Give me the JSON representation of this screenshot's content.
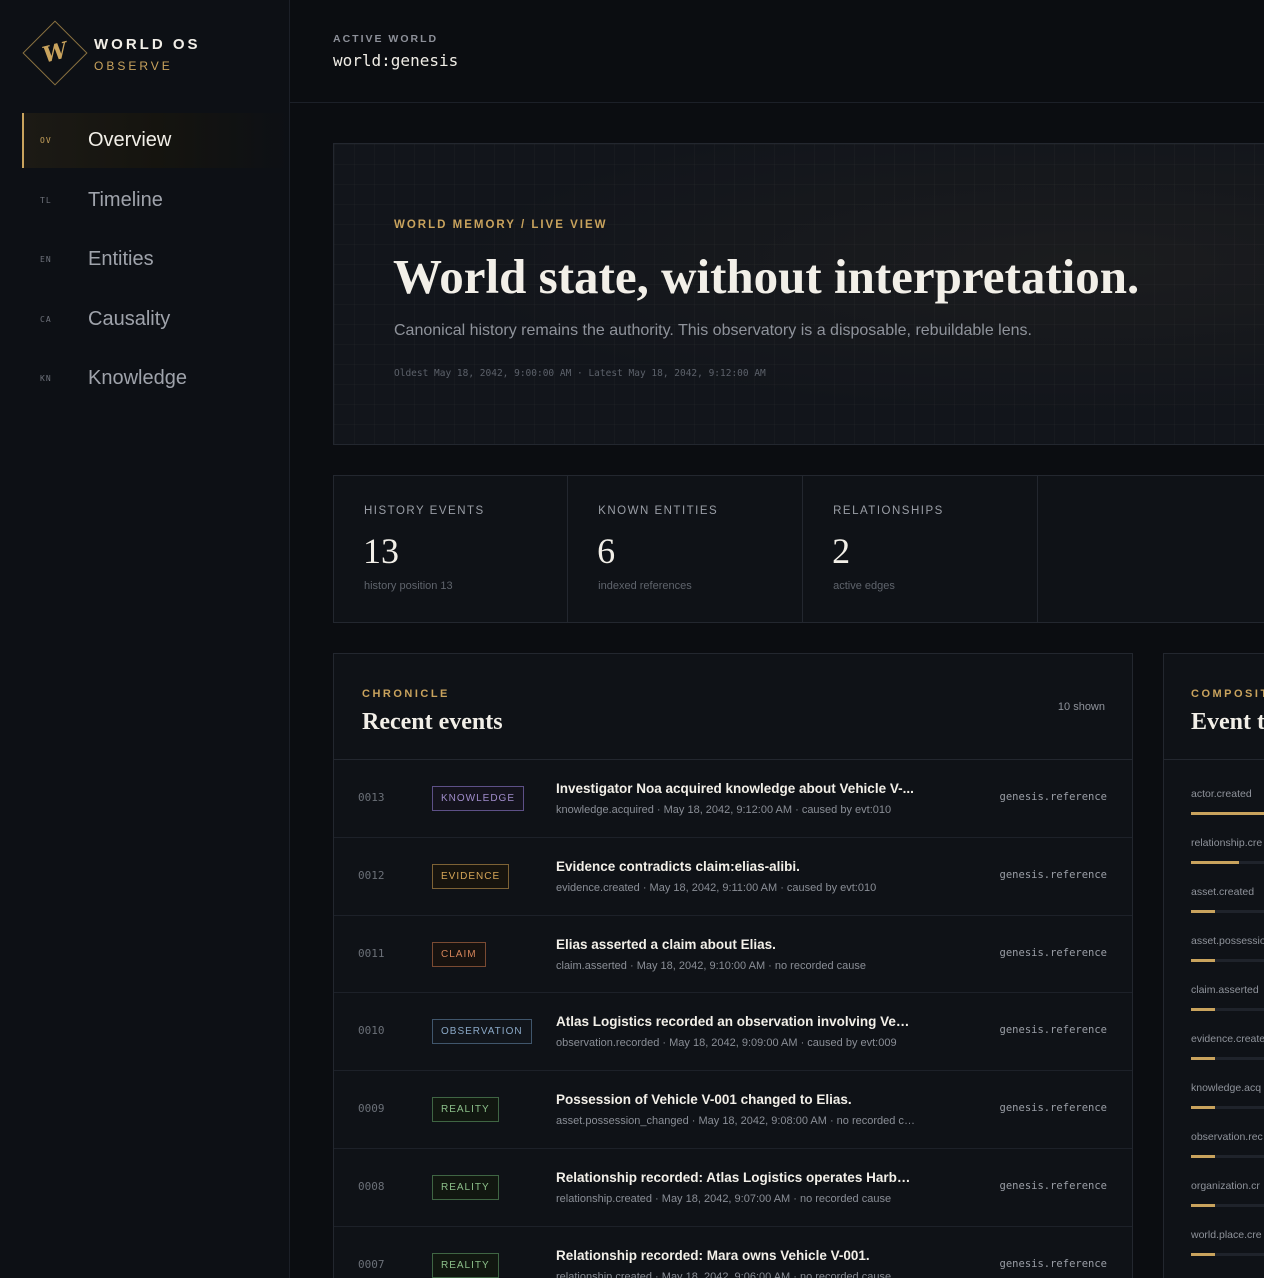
{
  "brand": {
    "glyph": "W",
    "title": "WORLD OS",
    "subtitle": "OBSERVE"
  },
  "nav": [
    {
      "code": "OV",
      "label": "Overview",
      "active": true
    },
    {
      "code": "TL",
      "label": "Timeline"
    },
    {
      "code": "EN",
      "label": "Entities"
    },
    {
      "code": "CA",
      "label": "Causality"
    },
    {
      "code": "KN",
      "label": "Knowledge"
    }
  ],
  "header": {
    "label": "ACTIVE WORLD",
    "value": "world:genesis"
  },
  "hero": {
    "kicker": "WORLD MEMORY / LIVE VIEW",
    "title": "World state, without interpretation.",
    "subtitle": "Canonical history remains the authority. This observatory is a disposable, rebuildable lens.",
    "meta": "Oldest May 18, 2042, 9:00:00 AM · Latest May 18, 2042, 9:12:00 AM"
  },
  "stats": [
    {
      "label": "HISTORY EVENTS",
      "value": "13",
      "note": "history position 13"
    },
    {
      "label": "KNOWN ENTITIES",
      "value": "6",
      "note": "indexed references"
    },
    {
      "label": "RELATIONSHIPS",
      "value": "2",
      "note": "active edges"
    }
  ],
  "chronicle": {
    "kicker": "CHRONICLE",
    "title": "Recent events",
    "count": "10 shown",
    "events": [
      {
        "seq": "0013",
        "badge": "KNOWLEDGE",
        "kind": "knowledge",
        "title": "Investigator Noa acquired knowledge about Vehicle V-...",
        "meta": "knowledge.acquired · May 18, 2042, 9:12:00 AM · caused by evt:010",
        "source": "genesis.reference"
      },
      {
        "seq": "0012",
        "badge": "EVIDENCE",
        "kind": "evidence",
        "title": "Evidence contradicts claim:elias-alibi.",
        "meta": "evidence.created · May 18, 2042, 9:11:00 AM · caused by evt:010",
        "source": "genesis.reference"
      },
      {
        "seq": "0011",
        "badge": "CLAIM",
        "kind": "claim",
        "title": "Elias asserted a claim about Elias.",
        "meta": "claim.asserted · May 18, 2042, 9:10:00 AM · no recorded cause",
        "source": "genesis.reference"
      },
      {
        "seq": "0010",
        "badge": "OBSERVATION",
        "kind": "observation",
        "title": "Atlas Logistics recorded an observation involving Vehicl...",
        "meta": "observation.recorded · May 18, 2042, 9:09:00 AM · caused by evt:009",
        "source": "genesis.reference"
      },
      {
        "seq": "0009",
        "badge": "REALITY",
        "kind": "reality",
        "title": "Possession of Vehicle V-001 changed to Elias.",
        "meta": "asset.possession_changed · May 18, 2042, 9:08:00 AM · no recorded ca...",
        "source": "genesis.reference"
      },
      {
        "seq": "0008",
        "badge": "REALITY",
        "kind": "reality",
        "title": "Relationship recorded: Atlas Logistics operates Harbor ...",
        "meta": "relationship.created · May 18, 2042, 9:07:00 AM · no recorded cause",
        "source": "genesis.reference"
      },
      {
        "seq": "0007",
        "badge": "REALITY",
        "kind": "reality",
        "title": "Relationship recorded: Mara owns Vehicle V-001.",
        "meta": "relationship.created · May 18, 2042, 9:06:00 AM · no recorded cause",
        "source": "genesis.reference"
      }
    ]
  },
  "composition": {
    "kicker": "COMPOSIT",
    "title": "Event t",
    "items": [
      {
        "label": "actor.created",
        "fraction": 0.62
      },
      {
        "label": "relationship.cre",
        "fraction": 0.4
      },
      {
        "label": "asset.created",
        "fraction": 0.2
      },
      {
        "label": "asset.possessio",
        "fraction": 0.2
      },
      {
        "label": "claim.asserted",
        "fraction": 0.2
      },
      {
        "label": "evidence.create",
        "fraction": 0.2
      },
      {
        "label": "knowledge.acq",
        "fraction": 0.2
      },
      {
        "label": "observation.rec",
        "fraction": 0.2
      },
      {
        "label": "organization.cr",
        "fraction": 0.2
      },
      {
        "label": "world.place.cre",
        "fraction": 0.2
      }
    ]
  },
  "colors": {
    "accent": "#c9a35d",
    "background": "#0b0d11",
    "panel": "#0f1217"
  }
}
